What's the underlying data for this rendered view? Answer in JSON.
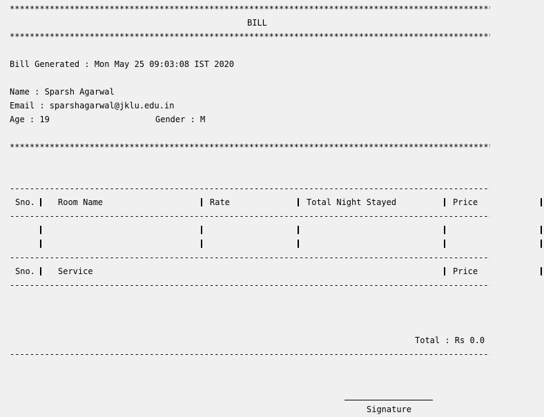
{
  "bill": {
    "stars": "****************************************************************************************************",
    "dashes": "----------------------------------------------------------------------------------------------------",
    "title": "BILL",
    "generated_label": "Bill Generated : ",
    "generated_value": "Mon May 25 09:03:08 IST 2020",
    "name_label": "Name : ",
    "name_value": "Sparsh Agarwal",
    "email_label": "Email : ",
    "email_value": "sparshagarwal@jklu.edu.in",
    "age_label": "Age : ",
    "age_value": "19",
    "gender_label": "Gender : ",
    "gender_value": "M"
  },
  "rooms_table": {
    "headers": [
      "Sno.",
      "Room Name",
      "Rate",
      "Total Night Stayed",
      "Price"
    ]
  },
  "services_table": {
    "headers": [
      "Sno.",
      "Service",
      "Price"
    ]
  },
  "total": {
    "label": "Total : ",
    "value": "Rs 0.0"
  },
  "signature": {
    "label": "Signature"
  }
}
